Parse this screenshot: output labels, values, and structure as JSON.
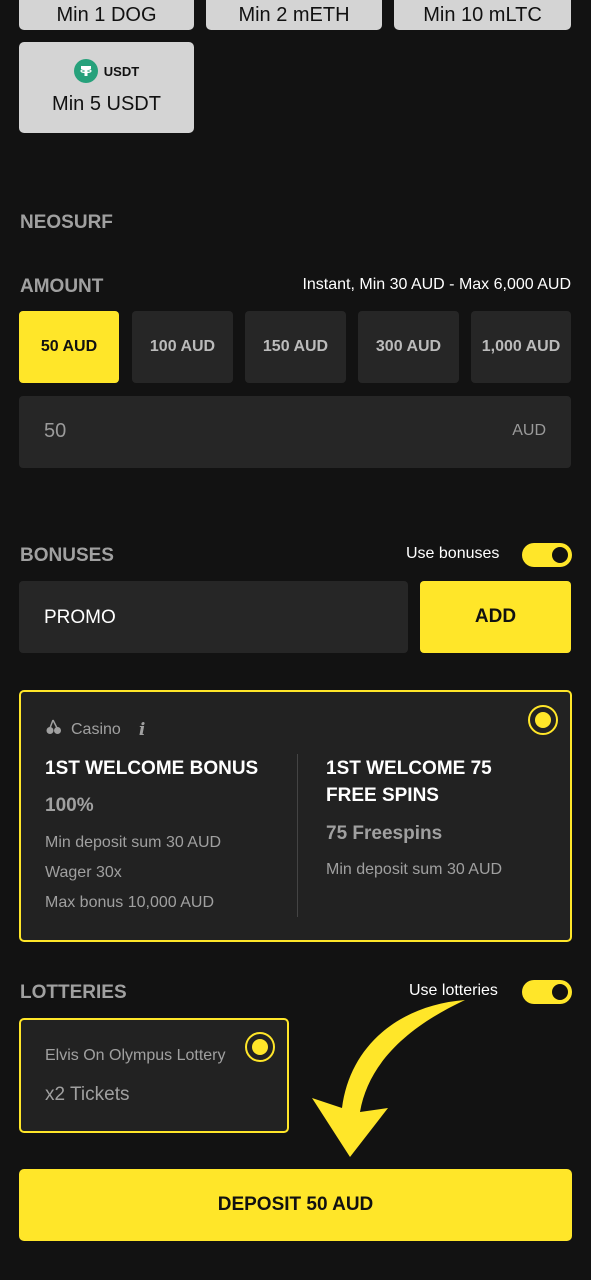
{
  "crypto_options": [
    {
      "label": "Min 1 DOG"
    },
    {
      "label": "Min 2 mETH"
    },
    {
      "label": "Min 10 mLTC"
    },
    {
      "label": "Min 5 USDT",
      "logo_text": "USDT",
      "logo_color": "#26a17b"
    }
  ],
  "method": {
    "title": "NEOSURF"
  },
  "amount": {
    "title": "AMOUNT",
    "hint": "Instant, Min 30 AUD - Max 6,000 AUD",
    "presets": [
      "50 AUD",
      "100 AUD",
      "150 AUD",
      "300 AUD",
      "1,000 AUD"
    ],
    "selected_index": 0,
    "value": "50",
    "currency": "AUD"
  },
  "bonuses": {
    "title": "BONUSES",
    "toggle_label": "Use bonuses",
    "toggle_on": true,
    "promo_placeholder": "PROMO",
    "add_label": "ADD",
    "card": {
      "category": "Casino",
      "info_icon": "info-icon",
      "selected": true,
      "left": {
        "name": "1ST WELCOME BONUS",
        "amount": "100%",
        "lines": [
          "Min deposit sum 30 AUD",
          "Wager 30x",
          "Max bonus 10,000 AUD"
        ]
      },
      "right": {
        "name": "1ST WELCOME 75 FREE SPINS",
        "amount": "75 Freespins",
        "lines": [
          "Min deposit sum 30 AUD"
        ]
      }
    }
  },
  "lotteries": {
    "title": "LOTTERIES",
    "toggle_label": "Use lotteries",
    "toggle_on": true,
    "card": {
      "name": "Elvis On Olympus Lottery",
      "tickets": "x2 Tickets",
      "selected": true
    }
  },
  "deposit_button": "DEPOSIT 50 AUD",
  "colors": {
    "accent": "#ffe629",
    "background": "#121212",
    "surface": "#262626"
  }
}
